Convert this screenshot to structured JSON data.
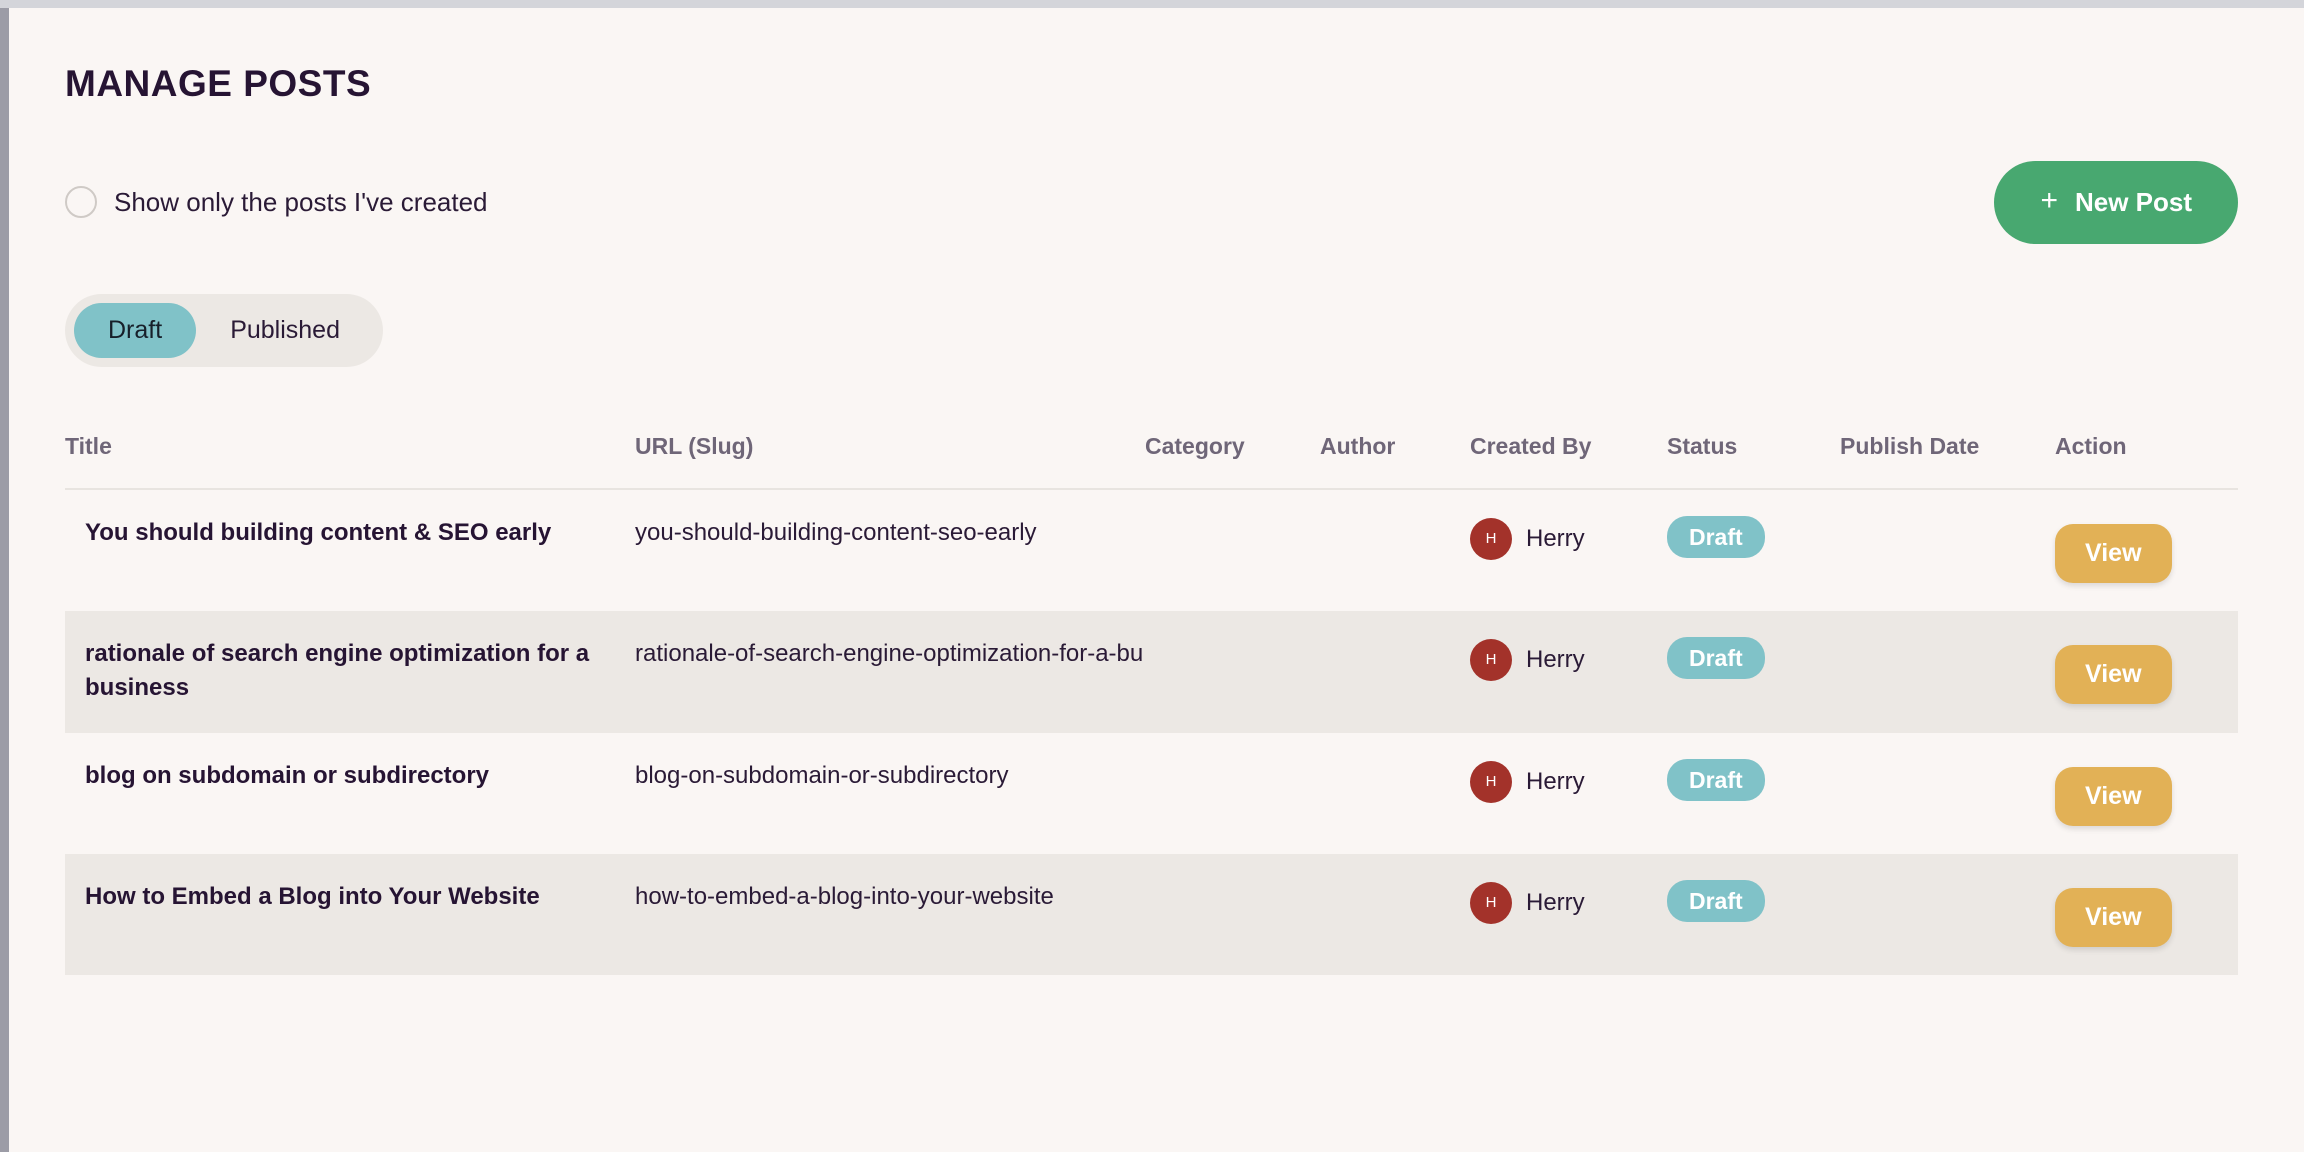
{
  "page": {
    "title": "MANAGE POSTS"
  },
  "filter": {
    "toggle_label": "Show only the posts I've created",
    "toggle_checked": false
  },
  "new_post_button": {
    "label": "New Post",
    "icon": "plus-icon",
    "color": "#48a870"
  },
  "tabs": {
    "items": [
      {
        "label": "Draft",
        "active": true
      },
      {
        "label": "Published",
        "active": false
      }
    ],
    "active_color": "#80c2c8",
    "track_color": "#ece8e4"
  },
  "table": {
    "columns": [
      "Title",
      "URL (Slug)",
      "Category",
      "Author",
      "Created By",
      "Status",
      "Publish Date",
      "Action"
    ],
    "rows": [
      {
        "title": "You should building content & SEO early",
        "url": "you-should-building-content-seo-early",
        "category": "",
        "author": "",
        "created_by": "Herry",
        "created_by_initial": "H",
        "status": "Draft",
        "publish_date": "",
        "action": "View"
      },
      {
        "title": "rationale of search engine optimization for a business",
        "url": "rationale-of-search-engine-optimization-for-a-bu",
        "category": "",
        "author": "",
        "created_by": "Herry",
        "created_by_initial": "H",
        "status": "Draft",
        "publish_date": "",
        "action": "View"
      },
      {
        "title": "blog on subdomain or subdirectory",
        "url": "blog-on-subdomain-or-subdirectory",
        "category": "",
        "author": "",
        "created_by": "Herry",
        "created_by_initial": "H",
        "status": "Draft",
        "publish_date": "",
        "action": "View"
      },
      {
        "title": "How to Embed a Blog into Your Website",
        "url": "how-to-embed-a-blog-into-your-website",
        "category": "",
        "author": "",
        "created_by": "Herry",
        "created_by_initial": "H",
        "status": "Draft",
        "publish_date": "",
        "action": "View"
      }
    ],
    "status_color": "#80c2c8",
    "action_color": "#e2b156",
    "avatar_color": "#a3322a",
    "stripe_color": "#ece8e4"
  }
}
